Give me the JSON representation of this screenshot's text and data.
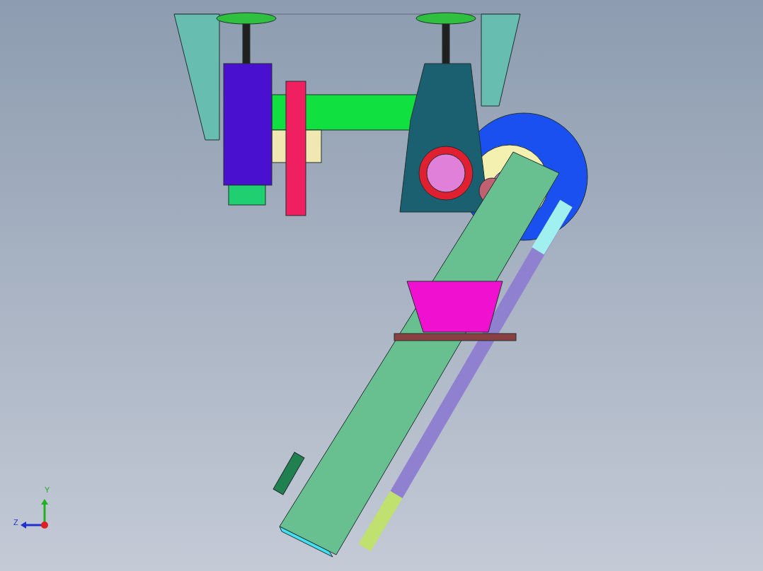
{
  "viewport": {
    "triad": {
      "labels": [
        {
          "text": "Y"
        },
        {
          "text": "Z"
        }
      ]
    }
  }
}
